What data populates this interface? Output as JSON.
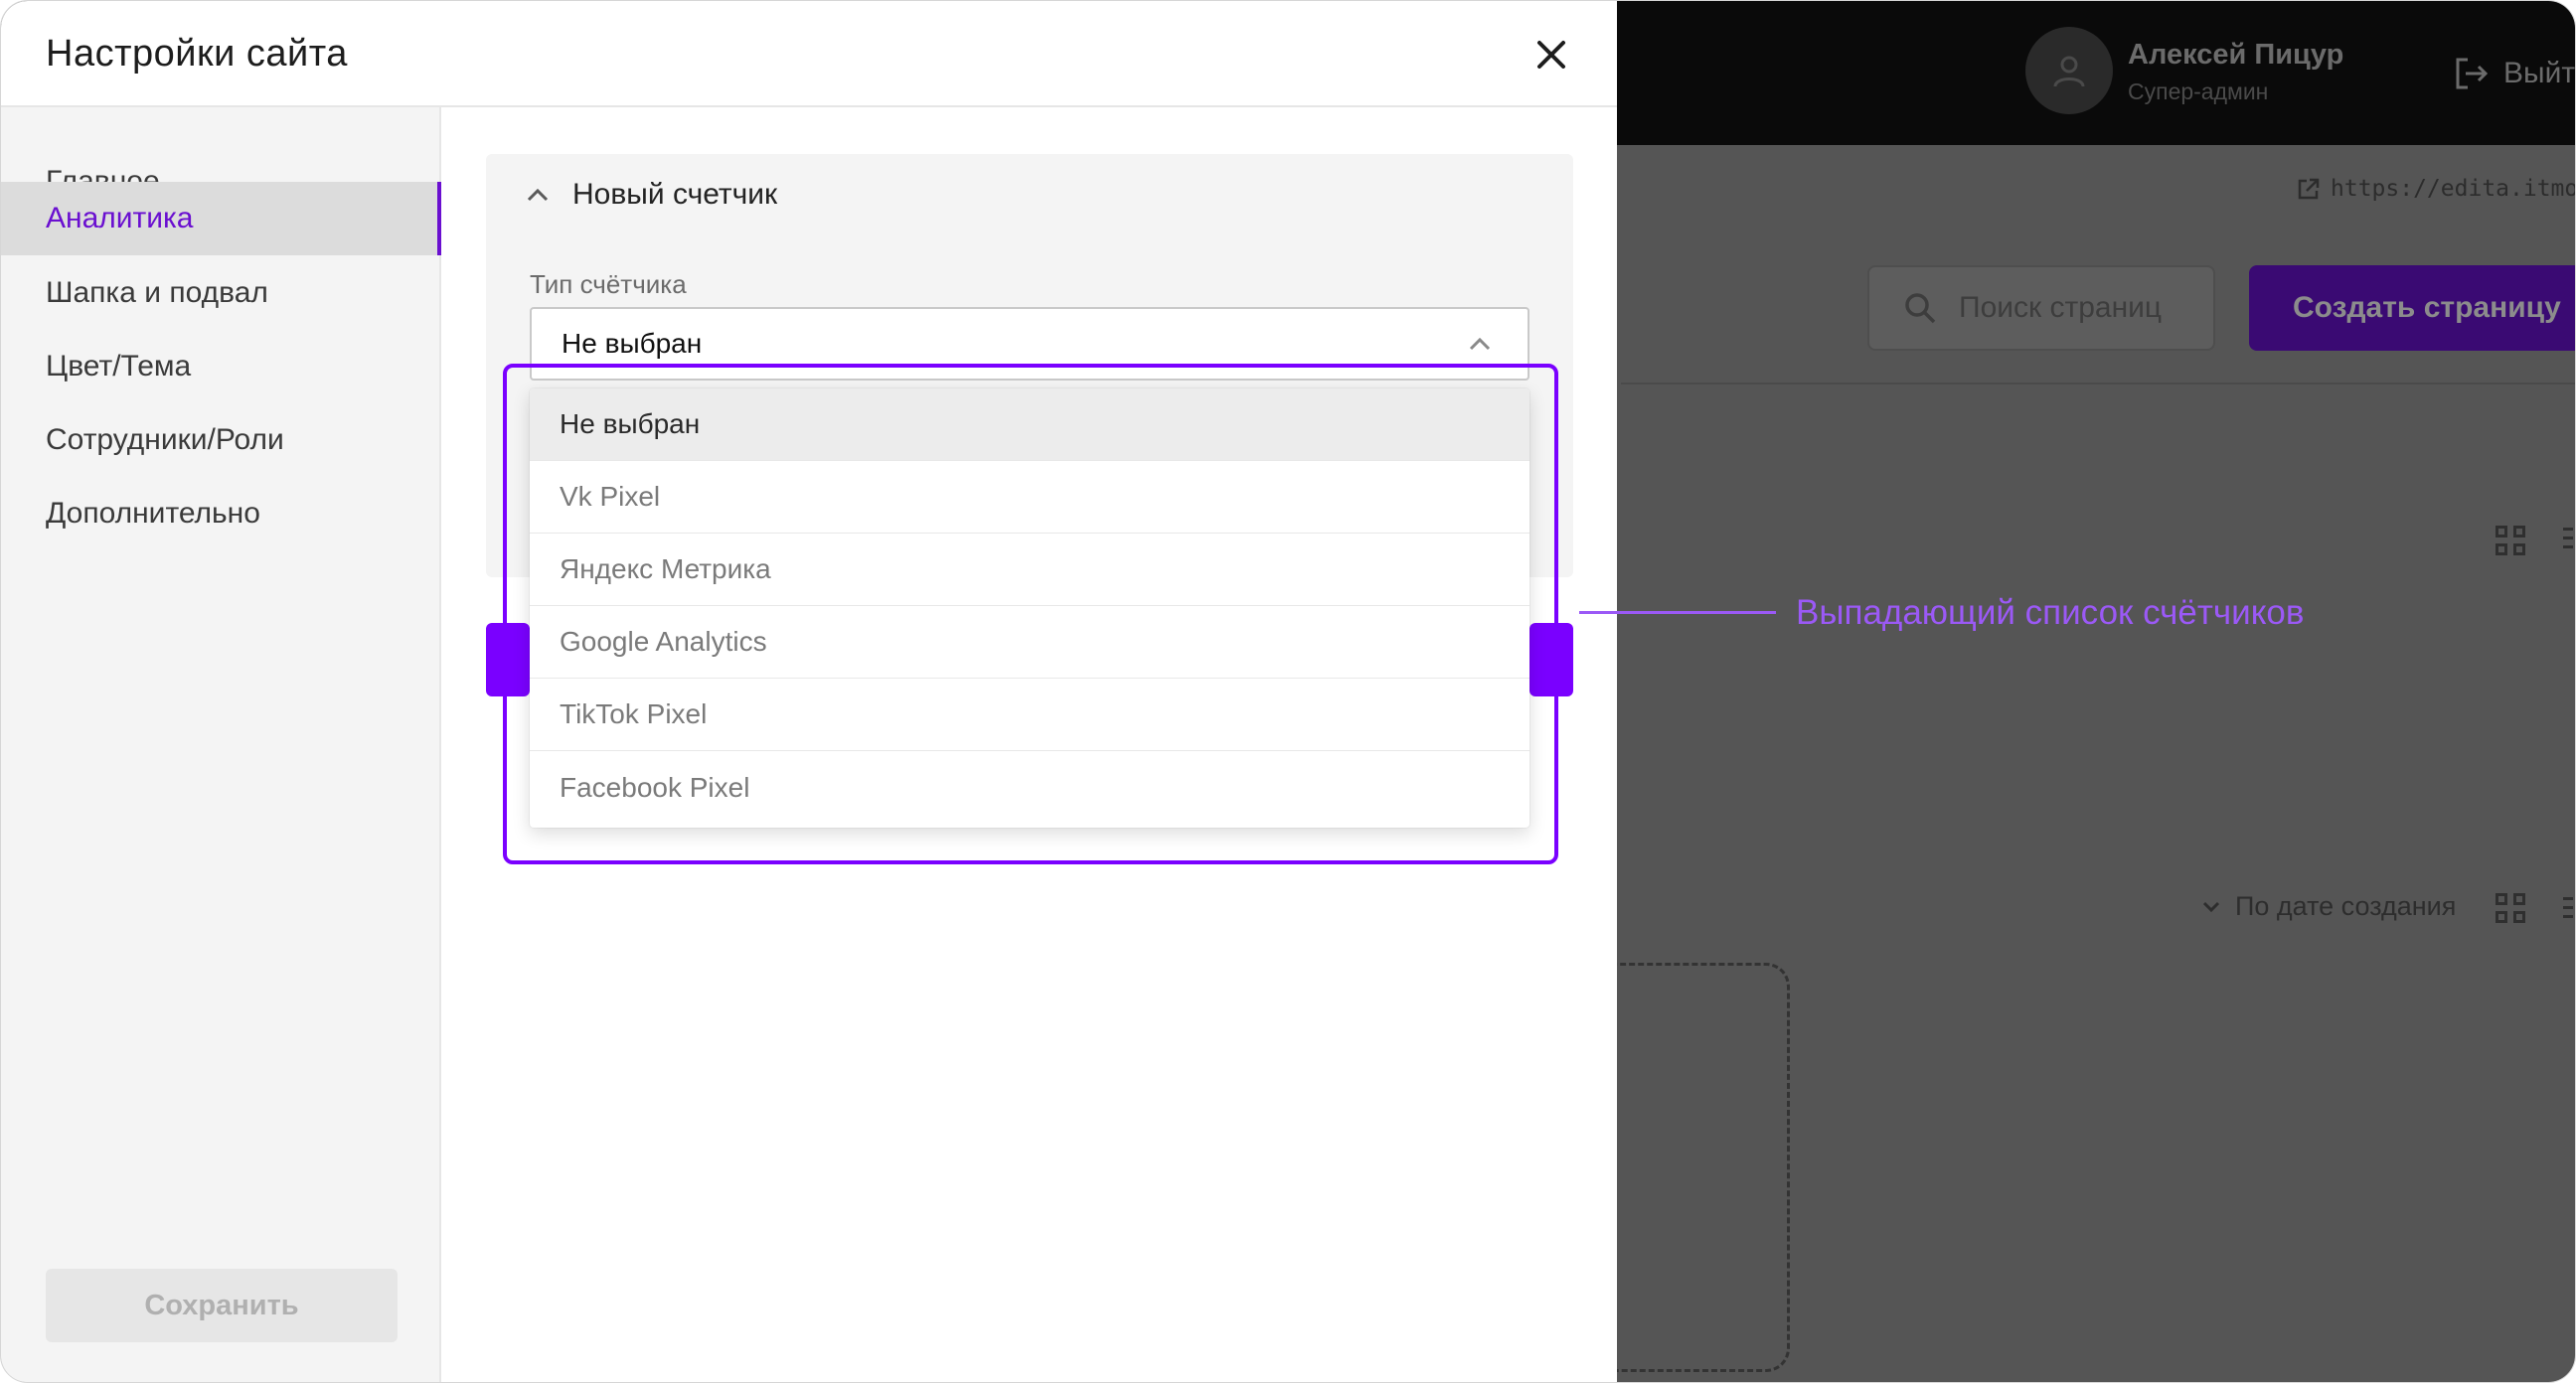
{
  "modal": {
    "title": "Настройки сайта",
    "nav": [
      {
        "label": "Главное",
        "active": false
      },
      {
        "label": "Аналитика",
        "active": true
      },
      {
        "label": "Шапка и подвал",
        "active": false
      },
      {
        "label": "Цвет/Тема",
        "active": false
      },
      {
        "label": "Сотрудники/Роли",
        "active": false
      },
      {
        "label": "Дополнительно",
        "active": false
      }
    ],
    "save_label": "Сохранить"
  },
  "counter": {
    "panel_title": "Новый счетчик",
    "type_label": "Тип счётчика",
    "selected_value": "Не выбран",
    "options": [
      {
        "label": "Не выбран",
        "selected": true
      },
      {
        "label": "Vk Pixel",
        "selected": false
      },
      {
        "label": "Яндекс Метрика",
        "selected": false
      },
      {
        "label": "Google Analytics",
        "selected": false
      },
      {
        "label": "TikTok Pixel",
        "selected": false
      },
      {
        "label": "Facebook Pixel",
        "selected": false
      }
    ]
  },
  "annotation": {
    "text": "Выпадающий список счётчиков",
    "color": "#9b59f6"
  },
  "background_app": {
    "user_name": "Алексей Пицур",
    "user_role": "Супер-админ",
    "logout_label": "Выйти",
    "site_url": "https://edita.itmo.ru/",
    "search_placeholder": "Поиск страниц",
    "create_page_label": "Создать страницу",
    "sort_label": "По дате создания"
  },
  "colors": {
    "accent": "#6a0fd0",
    "highlight": "#7a00ff",
    "overlay": "#555555"
  }
}
